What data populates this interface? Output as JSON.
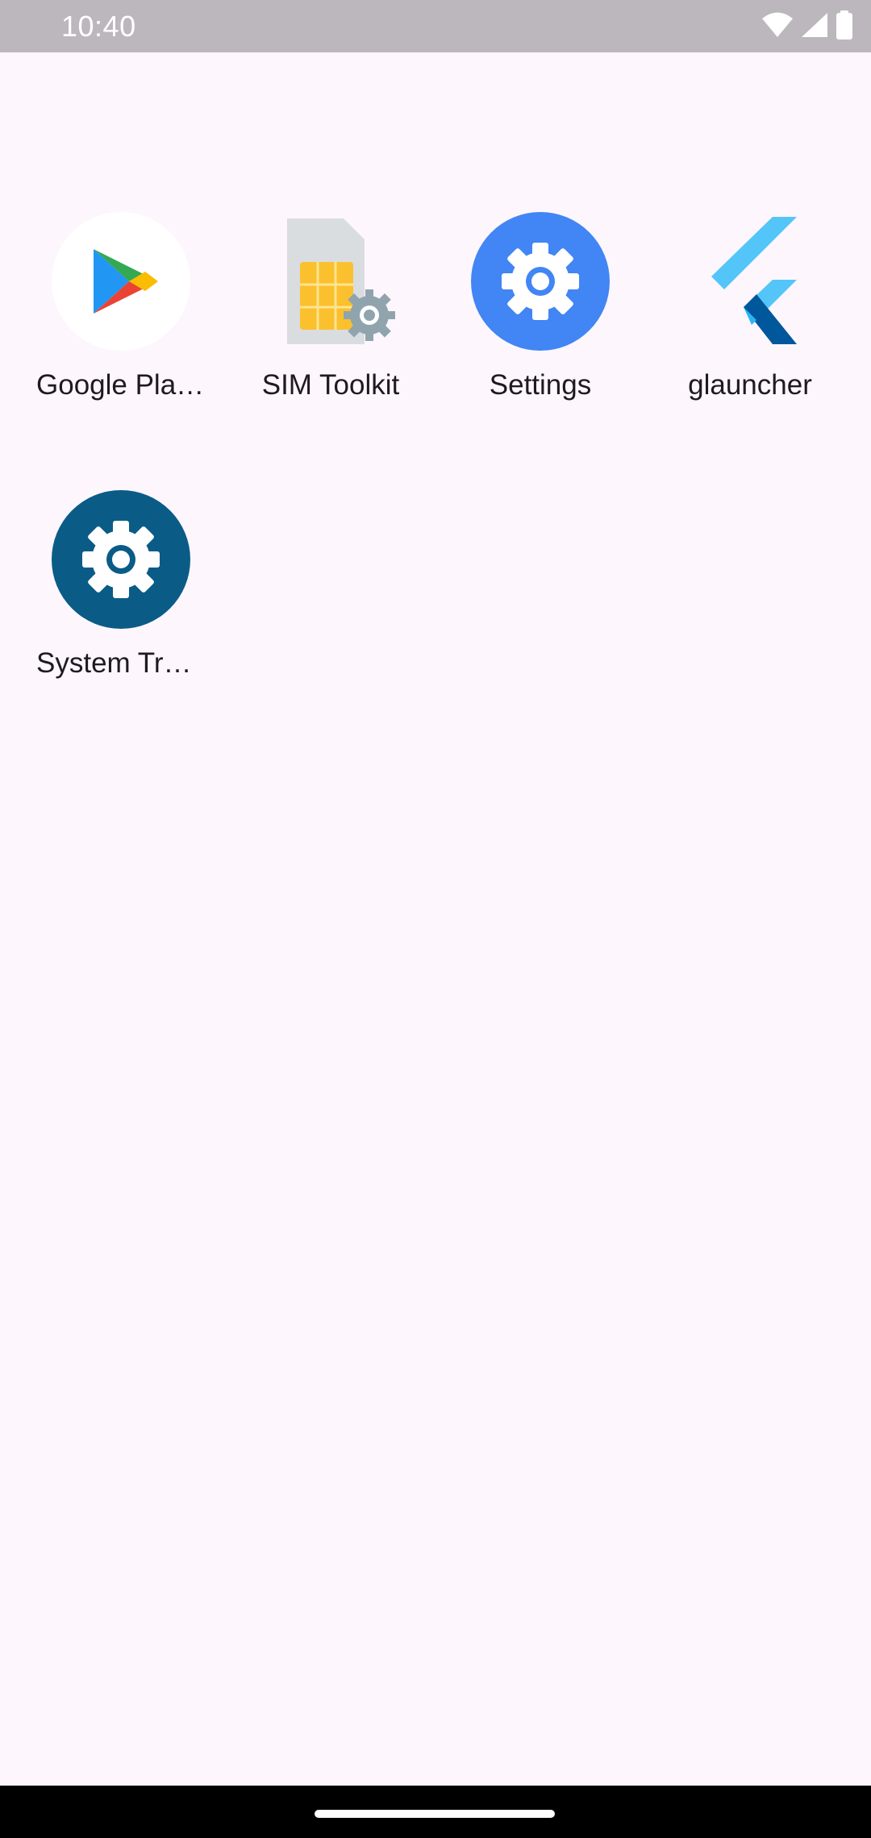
{
  "status_bar": {
    "time": "10:40",
    "icons": [
      "wifi-icon",
      "cellular-signal-icon",
      "battery-icon"
    ],
    "background": "#bcb7bd"
  },
  "apps": [
    {
      "label": "Google Play Store",
      "icon": "google-play-icon"
    },
    {
      "label": "SIM Toolkit",
      "icon": "sim-toolkit-icon"
    },
    {
      "label": "Settings",
      "icon": "settings-icon",
      "color": "#4285f4"
    },
    {
      "label": "glauncher",
      "icon": "flutter-icon"
    },
    {
      "label": "System Tracing",
      "icon": "system-tracing-icon",
      "color": "#0a5c87"
    }
  ],
  "nav_bar": {
    "gesture_handle": "home-gesture-handle"
  },
  "colors": {
    "background": "#fdf6fd",
    "label_text": "#1f1a21"
  }
}
